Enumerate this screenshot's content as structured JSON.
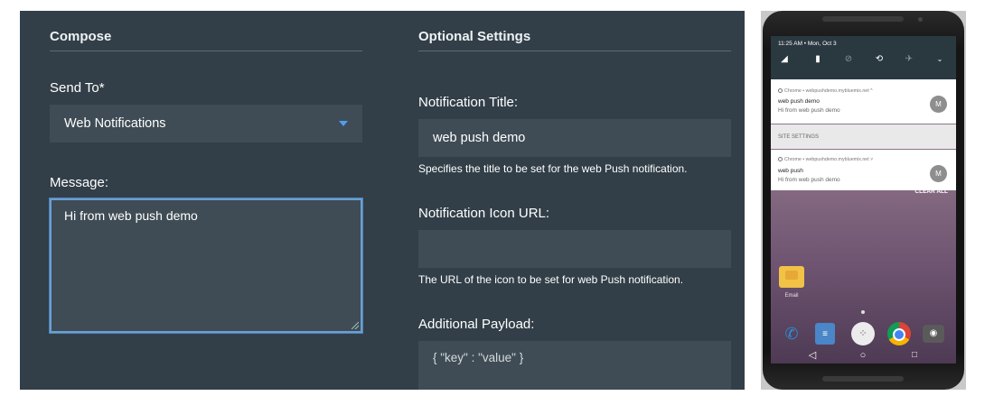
{
  "compose": {
    "title": "Compose",
    "send_to_label": "Send To*",
    "send_to_value": "Web Notifications",
    "message_label": "Message:",
    "message_value": "Hi from web push demo"
  },
  "optional": {
    "title": "Optional Settings",
    "notification_title_label": "Notification Title:",
    "notification_title_value": "web push demo",
    "notification_title_help": "Specifies the title to be set for the web Push notification.",
    "icon_url_label": "Notification Icon URL:",
    "icon_url_value": "",
    "icon_url_help": "The URL of the icon to be set for web Push notification.",
    "payload_label": "Additional Payload:",
    "payload_placeholder": "{ \"key\" : \"value\" }"
  },
  "phone": {
    "status": "11:25 AM • Mon, Oct 3",
    "notifications": [
      {
        "app": "Chrome • webpushdemo.mybluemix.net ^",
        "title": "web push demo",
        "body": "Hi from web push demo",
        "avatar": "M"
      },
      {
        "app": "Chrome • webpushdemo.mybluemix.net ˅",
        "title": "web push",
        "body": "Hi from web push demo",
        "avatar": "M"
      }
    ],
    "site_settings": "SITE SETTINGS",
    "clear_all": "CLEAR ALL",
    "email_label": "Email",
    "quick_settings_icons": [
      "signal-3g-icon",
      "battery-icon",
      "do-not-disturb-icon",
      "auto-rotate-icon",
      "airplane-icon",
      "expand-icon"
    ],
    "colors": {
      "panel": "#323f48",
      "field": "#3f4c55",
      "accent": "#4d9df2"
    }
  }
}
